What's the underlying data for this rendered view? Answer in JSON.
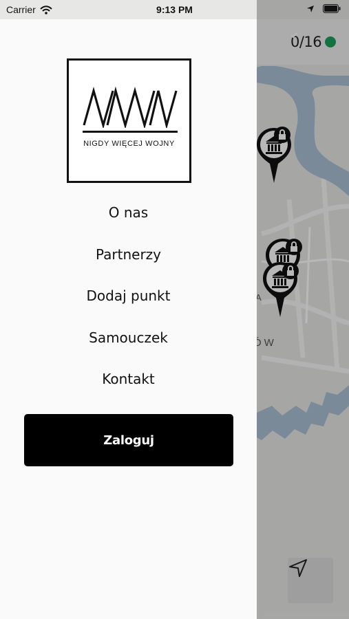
{
  "status_bar": {
    "carrier": "Carrier",
    "time": "9:13 PM",
    "icons": [
      "wifi-icon",
      "location-arrow-icon",
      "battery-icon"
    ]
  },
  "drawer": {
    "logo": {
      "mark": "NWW",
      "text": "NIGDY WIĘCEJ WOJNY"
    },
    "menu": [
      {
        "label": "O nas"
      },
      {
        "label": "Partnerzy"
      },
      {
        "label": "Dodaj punkt"
      },
      {
        "label": "Samouczek"
      },
      {
        "label": "Kontakt"
      }
    ],
    "login_label": "Zaloguj"
  },
  "map": {
    "progress": "0/16",
    "street_label": "ÓW",
    "street_label_2": "A",
    "pins": [
      {
        "icon": "museum-icon",
        "locked": true
      },
      {
        "icon": "museum-icon",
        "locked": true
      },
      {
        "icon": "museum-icon",
        "locked": true
      }
    ],
    "locate_icon": "navigation-arrow-icon"
  },
  "colors": {
    "accent": "#000000",
    "verified": "#1d9e58",
    "river": "#a9bfd3"
  }
}
